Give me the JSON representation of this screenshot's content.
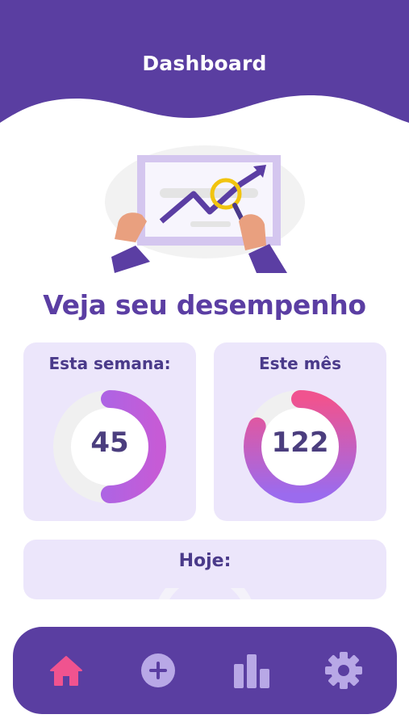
{
  "header": {
    "title": "Dashboard"
  },
  "hero": {
    "headline": "Veja seu desempenho",
    "illustration_icon": "chart-presentation-illustration"
  },
  "stats": {
    "week": {
      "label": "Esta semana:",
      "value": "45",
      "progress": 0.5
    },
    "month": {
      "label": "Este mês",
      "value": "122",
      "progress": 0.82
    },
    "today": {
      "label": "Hoje:"
    }
  },
  "nav": {
    "items": [
      {
        "icon": "home-icon",
        "active": true
      },
      {
        "icon": "add-circle-icon",
        "active": false
      },
      {
        "icon": "bar-chart-icon",
        "active": false
      },
      {
        "icon": "gear-icon",
        "active": false
      }
    ]
  },
  "colors": {
    "primary": "#5a3ea1",
    "card_bg": "#ece6fb",
    "accent_pink": "#f0538f",
    "ring_purple": "#9b6bee",
    "inactive_icon": "#b8a8e6"
  }
}
